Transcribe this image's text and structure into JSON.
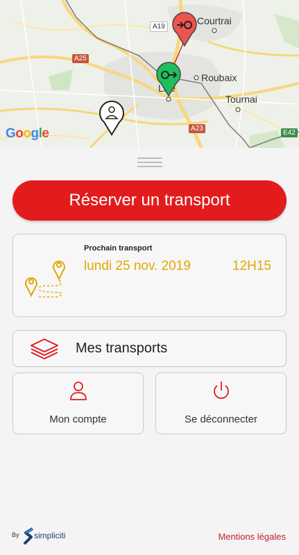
{
  "map": {
    "cities": {
      "kortrijk": "Courtrai",
      "roubaix": "Roubaix",
      "tournai": "Tournai",
      "lille": "Lille"
    },
    "roads": {
      "a19": "A19",
      "a25": "A25",
      "a23": "A23",
      "e42": "E42"
    },
    "attribution": [
      "G",
      "o",
      "o",
      "g",
      "l",
      "e"
    ],
    "markers": {
      "destination_color": "#ef5350",
      "origin_color": "#1fbf5e",
      "user_color": "#ffffff"
    }
  },
  "reserve": {
    "label": "Réserver un transport"
  },
  "next_transport": {
    "title": "Prochain transport",
    "date": "lundi 25 nov. 2019",
    "time": "12H15"
  },
  "my_transports": {
    "label": "Mes transports"
  },
  "account": {
    "label": "Mon compte"
  },
  "logout": {
    "label": "Se déconnecter"
  },
  "footer": {
    "by": "By",
    "brand": "simpliciti",
    "legal": "Mentions légales"
  },
  "colors": {
    "primary": "#e21c1c",
    "accent": "#e5a500",
    "brand": "#1d3f70"
  }
}
